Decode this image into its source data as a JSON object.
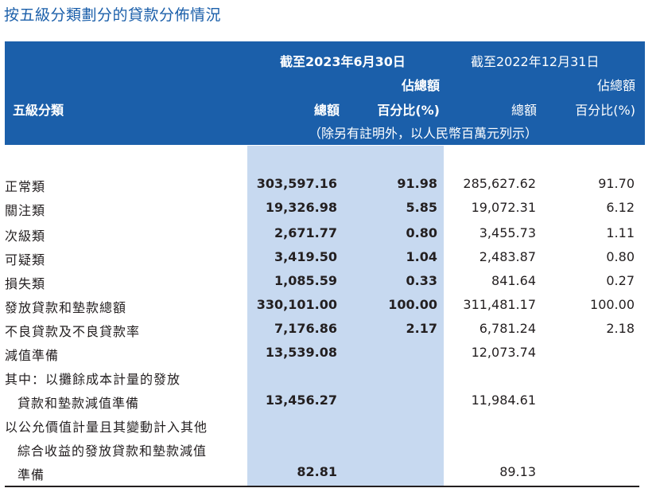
{
  "title": "按五級分類劃分的貸款分佈情況",
  "header": {
    "period1": "截至2023年6月30日",
    "period2": "截至2022年12月31日",
    "share_of_total_1": "佔總額",
    "share_of_total_2": "佔總額",
    "category_label": "五級分類",
    "amount_1": "總額",
    "percent_1": "百分比(%)",
    "amount_2": "總額",
    "percent_2": "百分比(%)",
    "unit_note": "（除另有註明外，以人民幣百萬元列示）"
  },
  "rows": [
    {
      "label": "正常類",
      "v1": "303,597.16",
      "p1": "91.98",
      "v2": "285,627.62",
      "p2": "91.70"
    },
    {
      "label": "關注類",
      "v1": "19,326.98",
      "p1": "5.85",
      "v2": "19,072.31",
      "p2": "6.12"
    },
    {
      "label": "次級類",
      "v1": "2,671.77",
      "p1": "0.80",
      "v2": "3,455.73",
      "p2": "1.11"
    },
    {
      "label": "可疑類",
      "v1": "3,419.50",
      "p1": "1.04",
      "v2": "2,483.87",
      "p2": "0.80"
    },
    {
      "label": "損失類",
      "v1": "1,085.59",
      "p1": "0.33",
      "v2": "841.64",
      "p2": "0.27"
    },
    {
      "label": "發放貸款和墊款總額",
      "v1": "330,101.00",
      "p1": "100.00",
      "v2": "311,481.17",
      "p2": "100.00"
    },
    {
      "label": "不良貸款及不良貸款率",
      "v1": "7,176.86",
      "p1": "2.17",
      "v2": "6,781.24",
      "p2": "2.18"
    },
    {
      "label": "減值準備",
      "v1": "13,539.08",
      "p1": "",
      "v2": "12,073.74",
      "p2": ""
    },
    {
      "label": "其中：以攤餘成本計量的發放",
      "v1": "",
      "p1": "",
      "v2": "",
      "p2": ""
    },
    {
      "label": "貸款和墊款減值準備",
      "v1": "13,456.27",
      "p1": "",
      "v2": "11,984.61",
      "p2": ""
    },
    {
      "label": "以公允價值計量且其變動計入其他",
      "v1": "",
      "p1": "",
      "v2": "",
      "p2": ""
    },
    {
      "label": "綜合收益的發放貸款和墊款減值",
      "v1": "",
      "p1": "",
      "v2": "",
      "p2": ""
    },
    {
      "label": "準備",
      "v1": "82.81",
      "p1": "",
      "v2": "89.13",
      "p2": ""
    }
  ]
}
